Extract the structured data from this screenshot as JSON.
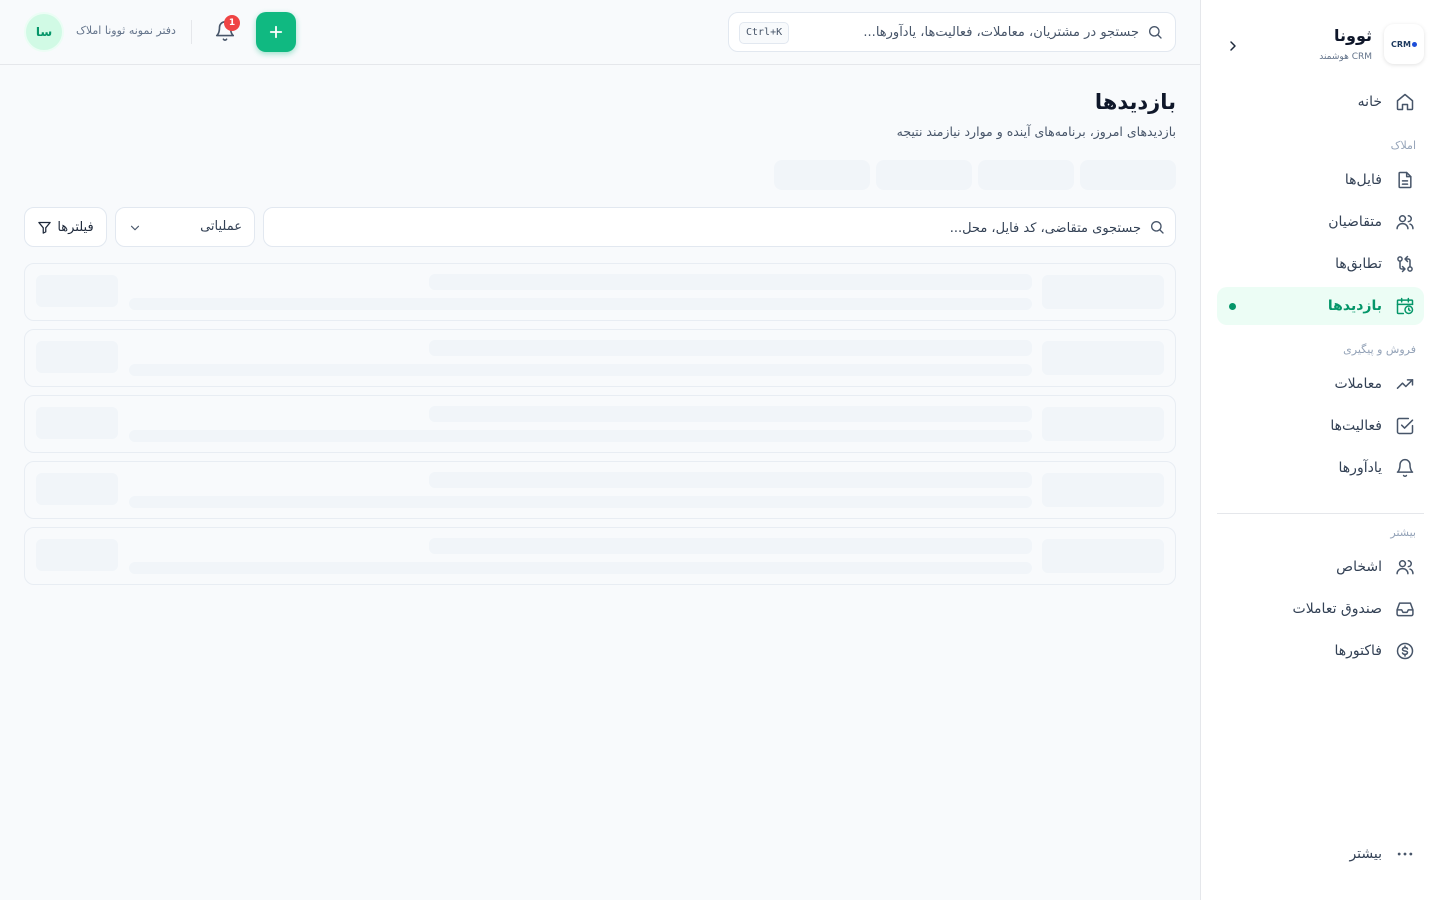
{
  "brand": {
    "name": "ثوونا",
    "subtitle": "CRM هوشمند",
    "logo_text": "CRM",
    "logo_icon": "crm-logo-icon"
  },
  "search": {
    "placeholder": "جستجو در مشتریان، معاملات، فعالیت‌ها، یادآورها...",
    "shortcut": "Ctrl+K"
  },
  "topbar": {
    "notification_count": "1",
    "org_name": "دفتر نمونه ثوونا املاک",
    "avatar_initials": "سا"
  },
  "sidebar": {
    "home": {
      "label": "خانه",
      "icon": "home-icon"
    },
    "section_properties": "املاک",
    "files": {
      "label": "فایل‌ها",
      "icon": "file-icon"
    },
    "applicants": {
      "label": "متقاضیان",
      "icon": "users-icon"
    },
    "matches": {
      "label": "تطابق‌ها",
      "icon": "git-compare-icon"
    },
    "visits": {
      "label": "بازدیدها",
      "icon": "calendar-clock-icon"
    },
    "section_sales": "فروش و پیگیری",
    "deals": {
      "label": "معاملات",
      "icon": "trending-up-icon"
    },
    "activities": {
      "label": "فعالیت‌ها",
      "icon": "check-square-icon"
    },
    "reminders": {
      "label": "یادآورها",
      "icon": "bell-icon"
    },
    "section_more": "بیشتر",
    "people": {
      "label": "اشخاص",
      "icon": "users-icon"
    },
    "cashbox": {
      "label": "صندوق تعاملات",
      "icon": "inbox-icon"
    },
    "invoices": {
      "label": "فاکتورها",
      "icon": "dollar-circle-icon"
    },
    "more": {
      "label": "بیشتر",
      "icon": "more-horizontal-icon"
    }
  },
  "page": {
    "title": "بازدیدها",
    "subtitle": "بازدیدهای امروز، برنامه‌های آینده و موارد نیازمند نتیجه"
  },
  "list_search": {
    "placeholder": "جستجوی متقاضی، کد فایل، محل..."
  },
  "view_select": {
    "selected": "عملیاتی"
  },
  "filters": {
    "label": "فیلترها"
  },
  "colors": {
    "accent": "#10b981",
    "accent_dark": "#059669",
    "badge": "#ef4444",
    "background": "#f8fafc"
  }
}
